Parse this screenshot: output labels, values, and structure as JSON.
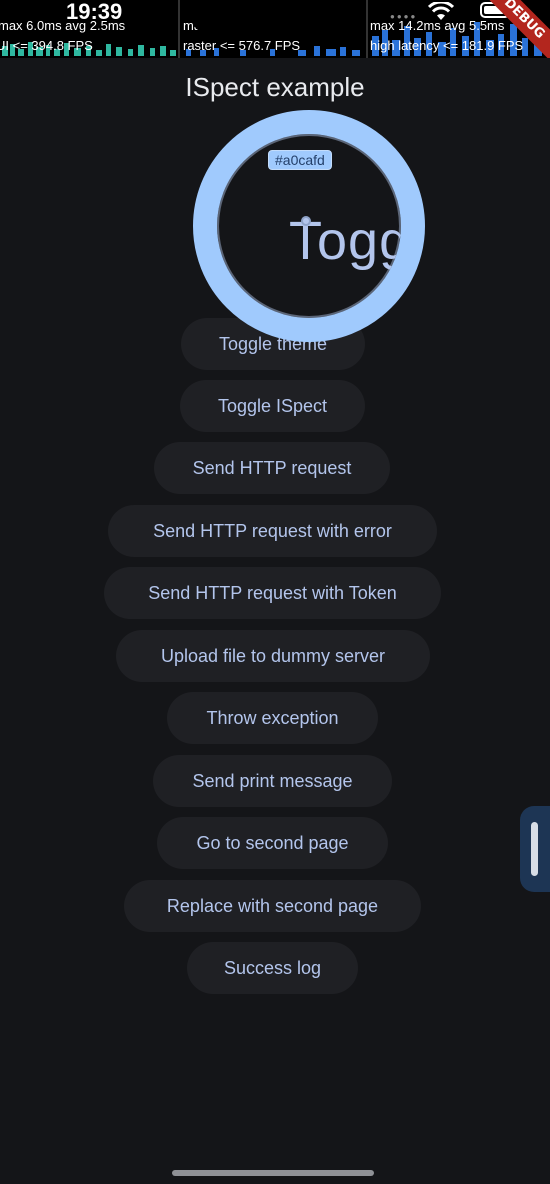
{
  "status_bar": {
    "time": "19:39",
    "perf_ui": {
      "line1": "max 6.0ms avg 2.5ms",
      "line2": "UI <= 394.8 FPS"
    },
    "perf_raster": {
      "line1": "ma",
      "line2": "raster <= 576.7 FPS"
    },
    "perf_latency": {
      "line1": "max 14.2ms avg 5.5ms",
      "line2": "high latency <= 181.9 FPS"
    },
    "debug_banner": "DEBUG"
  },
  "app": {
    "title": "ISpect example"
  },
  "magnifier": {
    "hex": "#a0cafd",
    "zoom_text": "Toggle",
    "color": "#a0cafd"
  },
  "buttons": [
    "Toggle theme",
    "Toggle ISpect",
    "Send HTTP request",
    "Send HTTP request with error",
    "Send HTTP request with Token",
    "Upload file to dummy server",
    "Throw exception",
    "Send print message",
    "Go to second page",
    "Replace with second page",
    "Success log"
  ],
  "colors": {
    "background": "#141518",
    "button_bg": "#1f2024",
    "button_text": "#b3c5ec",
    "accent": "#a0cafd"
  }
}
